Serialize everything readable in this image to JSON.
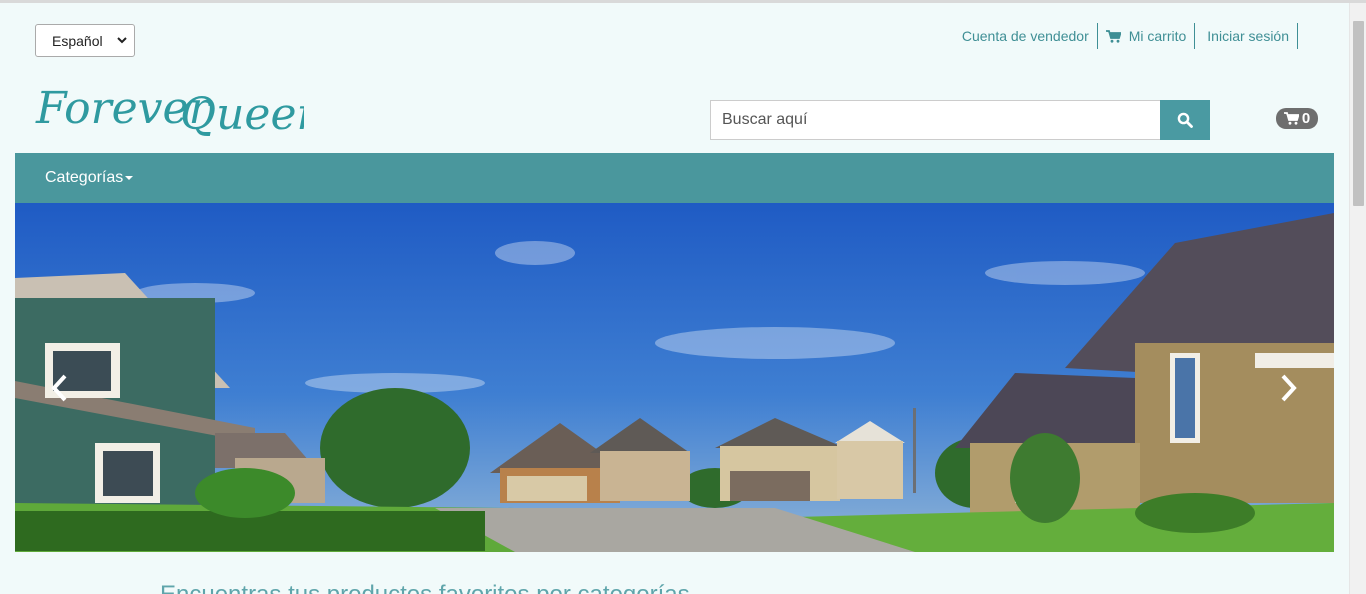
{
  "language_select": {
    "value": "Español"
  },
  "top_links": {
    "seller_account": "Cuenta de vendedor",
    "my_cart": "Mi carrito",
    "login": "Iniciar sesión"
  },
  "logo": {
    "text_line1": "Forever",
    "text_line2": "Queen"
  },
  "search": {
    "placeholder": "Buscar aquí"
  },
  "cart": {
    "count": "0"
  },
  "nav": {
    "categories_label": "Categorías"
  },
  "hero": {
    "image": "suburban-houses-street-banner"
  },
  "section": {
    "heading": "Encuentras tus productos favoritos por categorías"
  },
  "colors": {
    "accent": "#4a979d",
    "link": "#3f8f95",
    "background": "#f1fafa",
    "badge": "#6e6e6e"
  },
  "icons": {
    "cart": "cart-icon",
    "search": "search-icon",
    "prev": "chevron-left-icon",
    "next": "chevron-right-icon",
    "select": "chevron-down-icon"
  }
}
